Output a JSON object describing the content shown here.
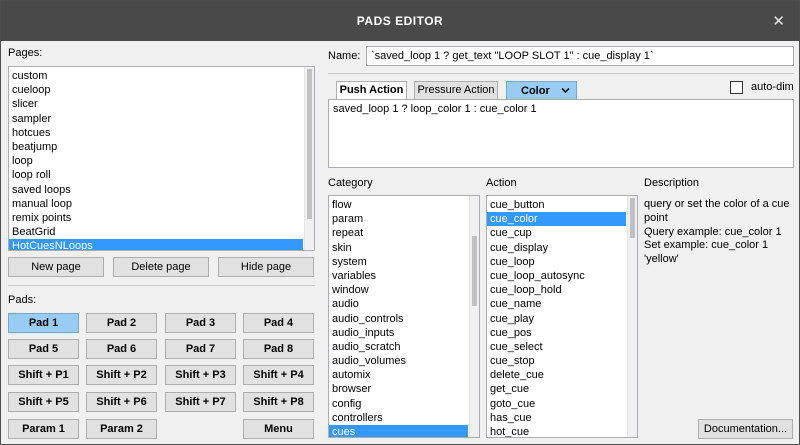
{
  "window": {
    "title": "PADS EDITOR",
    "close_glyph": "✕"
  },
  "pages": {
    "label": "Pages:",
    "items": [
      "custom",
      "cueloop",
      "slicer",
      "sampler",
      "hotcues",
      "beatjump",
      "loop",
      "loop roll",
      "saved loops",
      "manual loop",
      "remix points",
      "BeatGrid",
      "HotCuesNLoops"
    ],
    "selected_index": 12,
    "buttons": {
      "new": "New page",
      "delete": "Delete page",
      "hide": "Hide page"
    }
  },
  "pads": {
    "label": "Pads:",
    "rows": [
      [
        "Pad 1",
        "Pad 2",
        "Pad 3",
        "Pad 4"
      ],
      [
        "Pad 5",
        "Pad 6",
        "Pad 7",
        "Pad 8"
      ],
      [
        "Shift + P1",
        "Shift + P2",
        "Shift + P3",
        "Shift + P4"
      ],
      [
        "Shift + P5",
        "Shift + P6",
        "Shift + P7",
        "Shift + P8"
      ]
    ],
    "param1": "Param 1",
    "param2": "Param 2",
    "menu": "Menu",
    "active_pad": "Pad 1"
  },
  "name": {
    "label": "Name:",
    "value": "`saved_loop 1 ? get_text \"LOOP SLOT 1\" : cue_display 1`"
  },
  "tabs": {
    "push": "Push Action",
    "pressure": "Pressure Action",
    "color": "Color",
    "selected": "Push Action"
  },
  "color_dropdown_icon": "chevron-down-icon",
  "auto_dim": {
    "label": "auto-dim",
    "checked": false
  },
  "editor": {
    "text": "saved_loop 1 ? loop_color 1 : cue_color 1"
  },
  "category": {
    "label": "Category",
    "items": [
      "flow",
      "param",
      "repeat",
      "skin",
      "system",
      "variables",
      "window",
      "audio",
      "audio_controls",
      "audio_inputs",
      "audio_scratch",
      "audio_volumes",
      "automix",
      "browser",
      "config",
      "controllers",
      "cues"
    ],
    "selected_index": 16
  },
  "action": {
    "label": "Action",
    "items": [
      "cue_button",
      "cue_color",
      "cue_cup",
      "cue_display",
      "cue_loop",
      "cue_loop_autosync",
      "cue_loop_hold",
      "cue_name",
      "cue_play",
      "cue_pos",
      "cue_select",
      "cue_stop",
      "delete_cue",
      "get_cue",
      "goto_cue",
      "has_cue",
      "hot_cue"
    ],
    "selected_index": 1
  },
  "description": {
    "label": "Description",
    "lines": [
      "query or set the color of a cue point",
      "Query example: cue_color 1",
      "Set example: cue_color 1 'yellow'"
    ]
  },
  "documentation_button": "Documentation...",
  "colors": {
    "accent_selection": "#3399ff",
    "active_pad": "#99ccf5",
    "titlebar": "#494949"
  }
}
